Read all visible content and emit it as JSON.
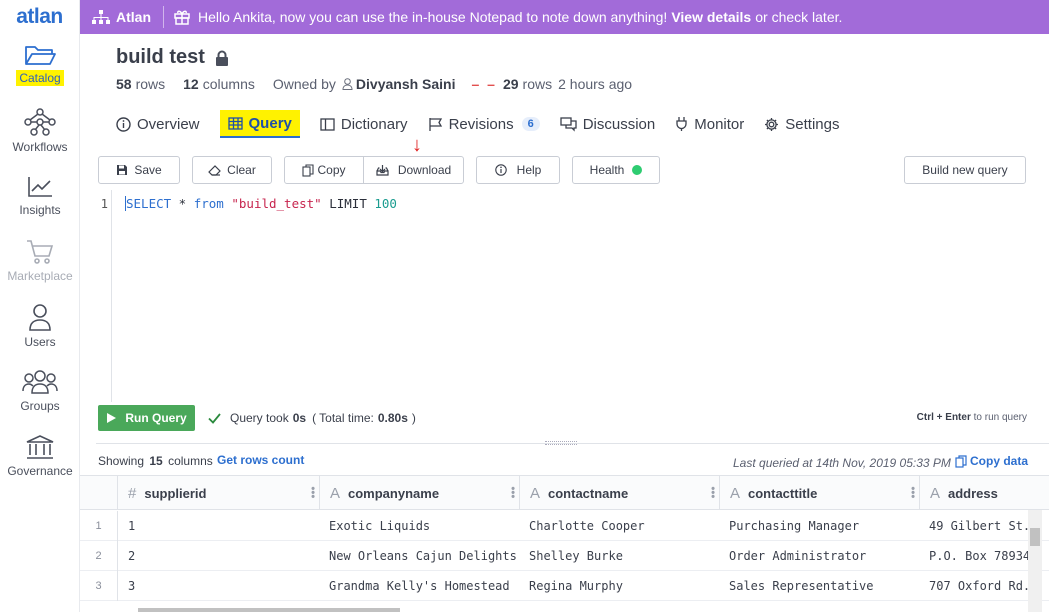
{
  "sidebar": {
    "logo": "atlan",
    "items": [
      {
        "label": "Catalog"
      },
      {
        "label": "Workflows"
      },
      {
        "label": "Insights"
      },
      {
        "label": "Marketplace"
      },
      {
        "label": "Users"
      },
      {
        "label": "Groups"
      },
      {
        "label": "Governance"
      }
    ]
  },
  "banner": {
    "brand": "Atlan",
    "message": "Hello Ankita, now you can use the in-house Notepad to note down anything!",
    "link": "View details",
    "suffix": "or check later."
  },
  "asset": {
    "title": "build test",
    "rows_count": "58",
    "rows_label": "rows",
    "cols_count": "12",
    "cols_label": "columns",
    "owned_by_label": "Owned by",
    "owner": "Divyansh Saini",
    "updated_rows": "29",
    "updated_rows_label": "rows",
    "updated_time": "2 hours ago"
  },
  "tabs": [
    {
      "label": "Overview"
    },
    {
      "label": "Query"
    },
    {
      "label": "Dictionary"
    },
    {
      "label": "Revisions",
      "badge": "6"
    },
    {
      "label": "Discussion"
    },
    {
      "label": "Monitor"
    },
    {
      "label": "Settings"
    }
  ],
  "toolbar": {
    "save": "Save",
    "clear": "Clear",
    "copy": "Copy",
    "download": "Download",
    "help": "Help",
    "health": "Health",
    "build_new": "Build new query",
    "health_color": "#2ecc71"
  },
  "editor": {
    "line": "1",
    "kw_select": "SELECT",
    "star": " * ",
    "kw_from": "from",
    "table": "\"build_test\"",
    "kw_limit": " LIMIT ",
    "limit": "100"
  },
  "run": {
    "button": "Run Query",
    "took_label": "Query took",
    "took_value": "0s",
    "total_prefix": "( Total time:",
    "total_value": "0.80s",
    "total_suffix": ")",
    "shortcut_keys": "Ctrl + Enter",
    "shortcut_text": "to run query"
  },
  "results": {
    "showing_prefix": "Showing",
    "showing_count": "15",
    "showing_suffix": "columns",
    "get_rows": "Get rows count",
    "last_queried": "Last queried at 14th Nov, 2019 05:33 PM",
    "copy_data": "Copy data",
    "columns": [
      {
        "type_icon": "#",
        "name": "supplierid"
      },
      {
        "type_icon": "A",
        "name": "companyname"
      },
      {
        "type_icon": "A",
        "name": "contactname"
      },
      {
        "type_icon": "A",
        "name": "contacttitle"
      },
      {
        "type_icon": "A",
        "name": "address"
      }
    ],
    "rows": [
      {
        "n": "1",
        "cells": [
          "1",
          "Exotic Liquids",
          "Charlotte Cooper",
          "Purchasing Manager",
          "49 Gilbert St."
        ]
      },
      {
        "n": "2",
        "cells": [
          "2",
          "New Orleans Cajun Delights",
          "Shelley Burke",
          "Order Administrator",
          "P.O. Box 78934"
        ]
      },
      {
        "n": "3",
        "cells": [
          "3",
          "Grandma Kelly's Homestead",
          "Regina Murphy",
          "Sales Representative",
          "707 Oxford Rd."
        ]
      }
    ]
  }
}
